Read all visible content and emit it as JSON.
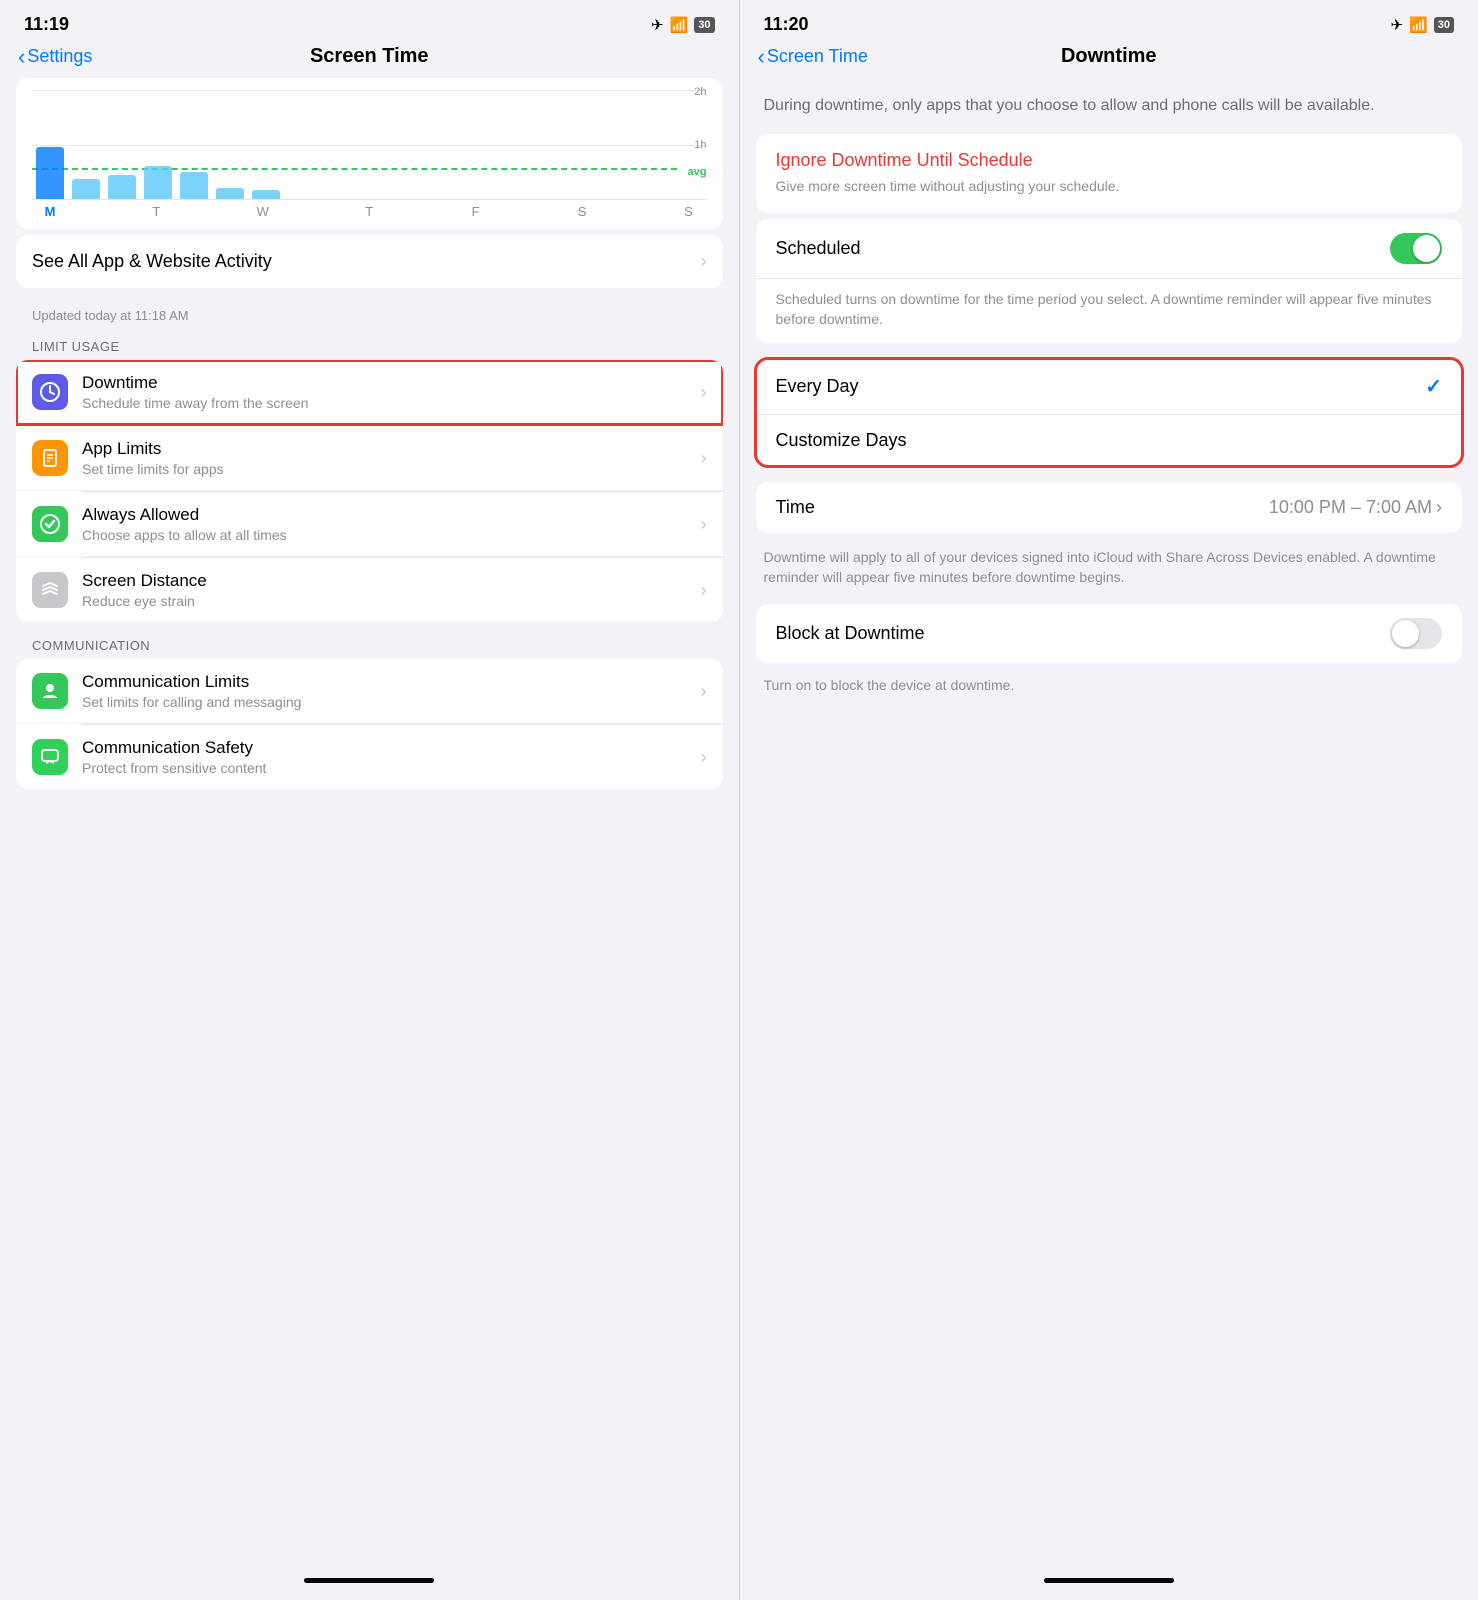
{
  "left": {
    "statusBar": {
      "time": "11:19",
      "icons": "✈ ⚡",
      "battery": "30"
    },
    "navBack": "Settings",
    "navTitle": "Screen Time",
    "chart": {
      "days": [
        "M",
        "T",
        "W",
        "T",
        "F",
        "S",
        "S"
      ],
      "activeDayIndex": 0,
      "bars": [
        48,
        18,
        22,
        30,
        25,
        10,
        8
      ],
      "avgLabel": "avg",
      "label2h": "2h",
      "label1h": "1h"
    },
    "seeAll": "See All App & Website Activity",
    "updatedText": "Updated today at 11:18 AM",
    "limitUsageHeader": "LIMIT USAGE",
    "items": [
      {
        "title": "Downtime",
        "subtitle": "Schedule time away from the screen",
        "iconBg": "icon-purple",
        "iconSymbol": "⏰",
        "highlighted": true
      },
      {
        "title": "App Limits",
        "subtitle": "Set time limits for apps",
        "iconBg": "icon-orange",
        "iconSymbol": "⏳",
        "highlighted": false
      },
      {
        "title": "Always Allowed",
        "subtitle": "Choose apps to allow at all times",
        "iconBg": "icon-green",
        "iconSymbol": "✔",
        "highlighted": false
      },
      {
        "title": "Screen Distance",
        "subtitle": "Reduce eye strain",
        "iconBg": "icon-gray",
        "iconSymbol": "≋",
        "highlighted": false
      }
    ],
    "communicationHeader": "COMMUNICATION",
    "commItems": [
      {
        "title": "Communication Limits",
        "subtitle": "Set limits for calling and messaging",
        "iconBg": "icon-green",
        "iconSymbol": "💬",
        "highlighted": false
      },
      {
        "title": "Communication Safety",
        "subtitle": "Protect from sensitive content",
        "iconBg": "icon-green2",
        "iconSymbol": "💬",
        "highlighted": false
      }
    ]
  },
  "right": {
    "statusBar": {
      "time": "11:20",
      "battery": "30"
    },
    "navBack": "Screen Time",
    "navTitle": "Downtime",
    "description": "During downtime, only apps that you choose to allow and phone calls will be available.",
    "ignoreButton": "Ignore Downtime Until Schedule",
    "ignoreSubtext": "Give more screen time without adjusting your schedule.",
    "scheduledLabel": "Scheduled",
    "scheduledDesc": "Scheduled turns on downtime for the time period you select. A downtime reminder will appear five minutes before downtime.",
    "options": [
      {
        "label": "Every Day",
        "checked": true
      },
      {
        "label": "Customize Days",
        "checked": false
      }
    ],
    "timeLabel": "Time",
    "timeValue": "10:00 PM – 7:00 AM",
    "timeDesc": "Downtime will apply to all of your devices signed into iCloud with Share Across Devices enabled. A downtime reminder will appear five minutes before downtime begins.",
    "blockLabel": "Block at Downtime",
    "blockDesc": "Turn on to block the device at downtime."
  }
}
